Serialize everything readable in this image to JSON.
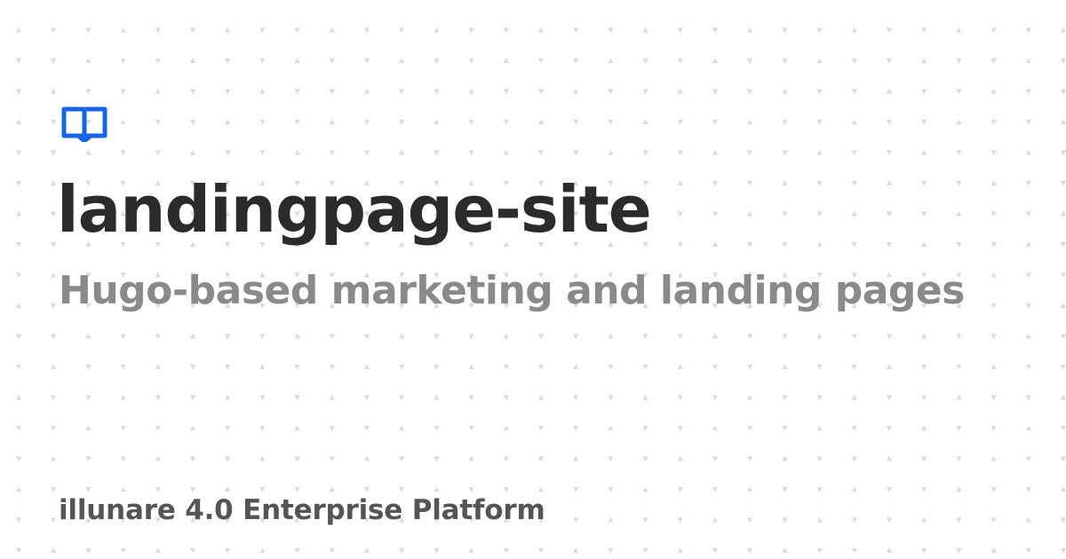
{
  "card": {
    "logo_icon": "open-book-icon",
    "title": "landingpage-site",
    "subtitle": "Hugo-based marketing and landing pages",
    "footer": "illunare 4.0 Enterprise Platform"
  },
  "colors": {
    "background": "#ffffff",
    "brand_blue": "#1565e6",
    "title": "#2b2b2b",
    "subtitle": "#8a8a8a",
    "footer": "#555555",
    "pattern": "#d8d8d8"
  },
  "background_pattern": {
    "icon": "small-triangle-dot-pattern"
  }
}
